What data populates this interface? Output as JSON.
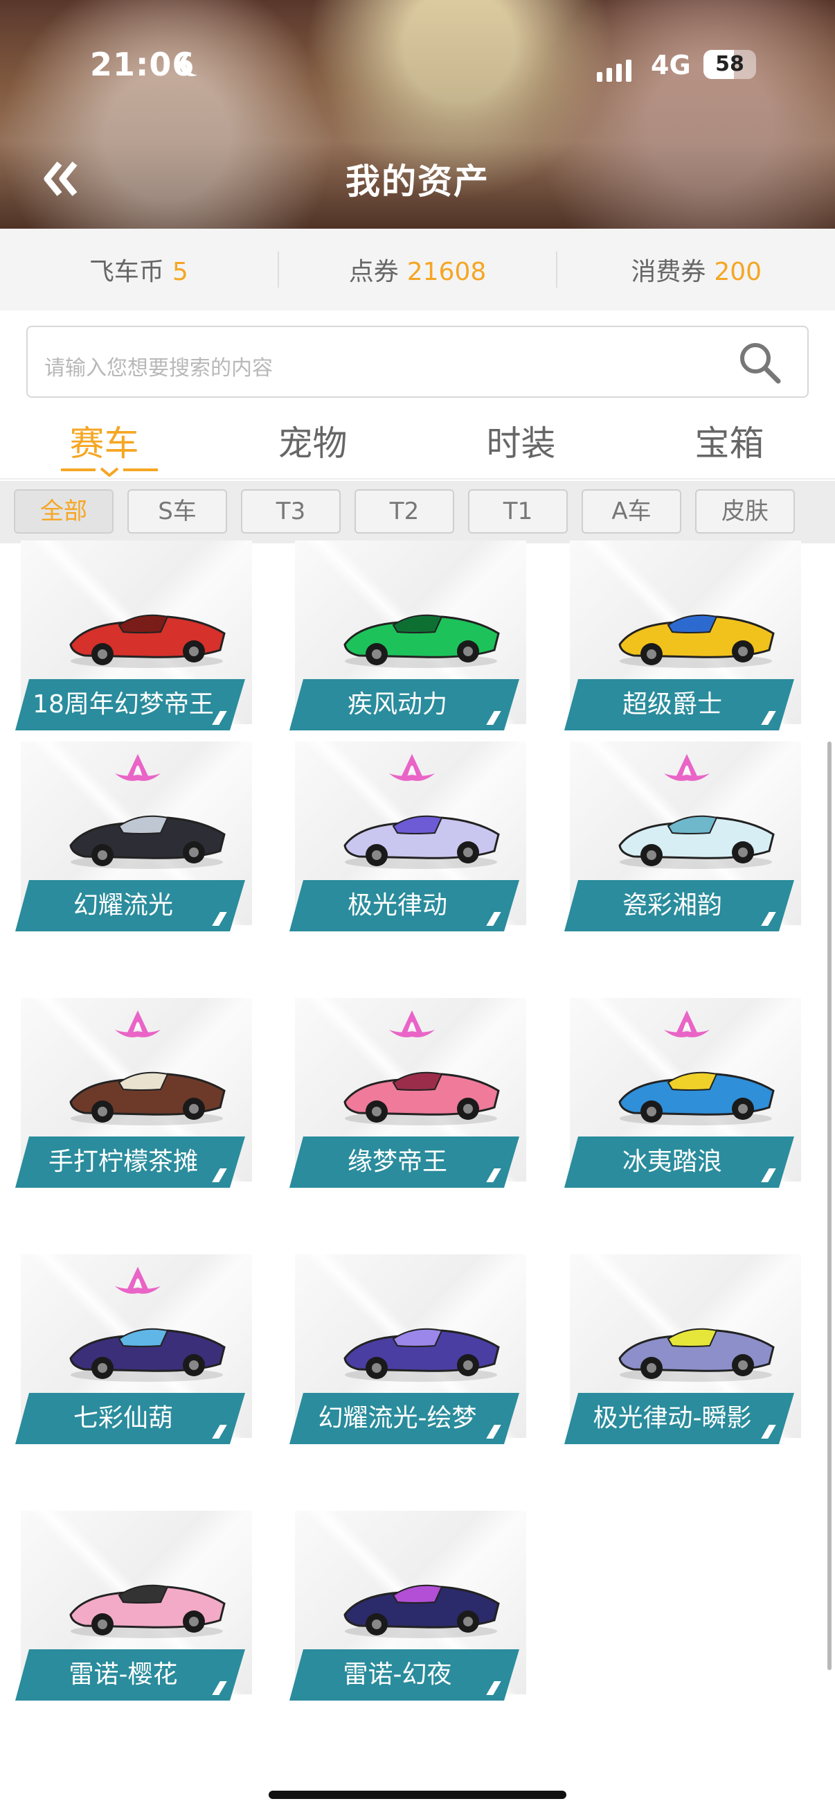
{
  "status_bar": {
    "time": "21:06",
    "network": "4G",
    "battery": "58",
    "battery_level": 0.58
  },
  "header": {
    "title": "我的资产",
    "back_icon": "double-chevron-left-icon"
  },
  "currencies": [
    {
      "label": "飞车币",
      "value": "5"
    },
    {
      "label": "点券",
      "value": "21608"
    },
    {
      "label": "消费券",
      "value": "200"
    }
  ],
  "search": {
    "placeholder": "请输入您想要搜索的内容",
    "icon": "search-icon"
  },
  "tabs": [
    {
      "label": "赛车",
      "active": true
    },
    {
      "label": "宠物"
    },
    {
      "label": "时装"
    },
    {
      "label": "宝箱"
    }
  ],
  "filters": [
    {
      "label": "全部",
      "active": true
    },
    {
      "label": "S车"
    },
    {
      "label": "T3"
    },
    {
      "label": "T2"
    },
    {
      "label": "T1"
    },
    {
      "label": "A车"
    },
    {
      "label": "皮肤"
    }
  ],
  "colors": {
    "accent": "#f5a623",
    "label_bg": "#2a8c9c",
    "badge": "#e964c6"
  },
  "cars": [
    {
      "name": "18周年幻梦帝王",
      "badge": false,
      "color": "#d6312b",
      "accent": "#7a1c17"
    },
    {
      "name": "疾风动力",
      "badge": false,
      "color": "#1dc35a",
      "accent": "#0e6f33"
    },
    {
      "name": "超级爵士",
      "badge": false,
      "color": "#f2c21c",
      "accent": "#2d6ad0"
    },
    {
      "name": "幻耀流光",
      "badge": true,
      "color": "#2d2d36",
      "accent": "#bfc7d3"
    },
    {
      "name": "极光律动",
      "badge": true,
      "color": "#c9c7f0",
      "accent": "#6d5bd6"
    },
    {
      "name": "瓷彩湘韵",
      "badge": true,
      "color": "#d7eef5",
      "accent": "#6fb8cc"
    },
    {
      "name": "手打柠檬茶摊",
      "badge": true,
      "color": "#6d3a2a",
      "accent": "#e8e2cf"
    },
    {
      "name": "缘梦帝王",
      "badge": true,
      "color": "#ef7a9a",
      "accent": "#9b2d4b"
    },
    {
      "name": "冰夷踏浪",
      "badge": true,
      "color": "#2f8fd9",
      "accent": "#f0d12a"
    },
    {
      "name": "七彩仙葫",
      "badge": true,
      "color": "#3b2f7a",
      "accent": "#5fb6e7"
    },
    {
      "name": "幻耀流光-绘梦",
      "badge": false,
      "color": "#4a3ea3",
      "accent": "#9b87ea"
    },
    {
      "name": "极光律动-瞬影",
      "badge": false,
      "color": "#8c8fc9",
      "accent": "#e6e63a"
    },
    {
      "name": "雷诺-樱花",
      "badge": false,
      "color": "#f3aac6",
      "accent": "#333333"
    },
    {
      "name": "雷诺-幻夜",
      "badge": false,
      "color": "#2b2a6a",
      "accent": "#b24fd6"
    }
  ]
}
